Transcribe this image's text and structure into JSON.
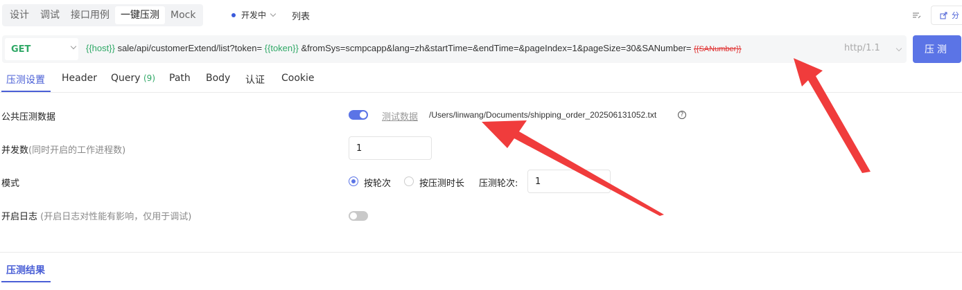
{
  "top_tabs": [
    "设计",
    "调试",
    "接口用例",
    "一键压测",
    "Mock"
  ],
  "environment": {
    "label": "开发中",
    "dot_color": "#3b5bdb"
  },
  "list_link": "列表",
  "right_button": "分",
  "request": {
    "method": "GET",
    "url_parts": {
      "host_var": "{{host}}",
      "path": " sale/api/customerExtend/list?token= ",
      "token_var": "{{token}}",
      "query": " &fromSys=scmpcapp&lang=zh&startTime=&endTime=&pageIndex=1&pageSize=30&SANumber= ",
      "sanumber_var": "{{SANumber}}"
    },
    "protocol": "http/1.1",
    "run_label": "压测"
  },
  "sub_tabs": {
    "settings": "压测设置",
    "header": "Header",
    "query": "Query",
    "query_count": "(9)",
    "path": "Path",
    "body": "Body",
    "auth": "认证",
    "cookie": "Cookie"
  },
  "settings": {
    "public_data": {
      "label": "公共压测数据",
      "enabled": true,
      "data_link": "测试数据",
      "file_path": "/Users/linwang/Documents/shipping_order_202506131052.txt"
    },
    "concurrency": {
      "label": "并发数",
      "hint": "(同时开启的工作进程数)",
      "value": "1"
    },
    "mode": {
      "label": "模式",
      "options": [
        "按轮次",
        "按压测时长"
      ],
      "selected": "按轮次",
      "rounds_label": "压测轮次:",
      "rounds_value": "1"
    },
    "log": {
      "label": "开启日志",
      "hint": " (开启日志对性能有影响，仅用于调试)",
      "enabled": false
    }
  },
  "result_tab": "压测结果",
  "colors": {
    "accent": "#5b74e6",
    "variable": "#2fa866",
    "annotation": "#f03c3c"
  }
}
